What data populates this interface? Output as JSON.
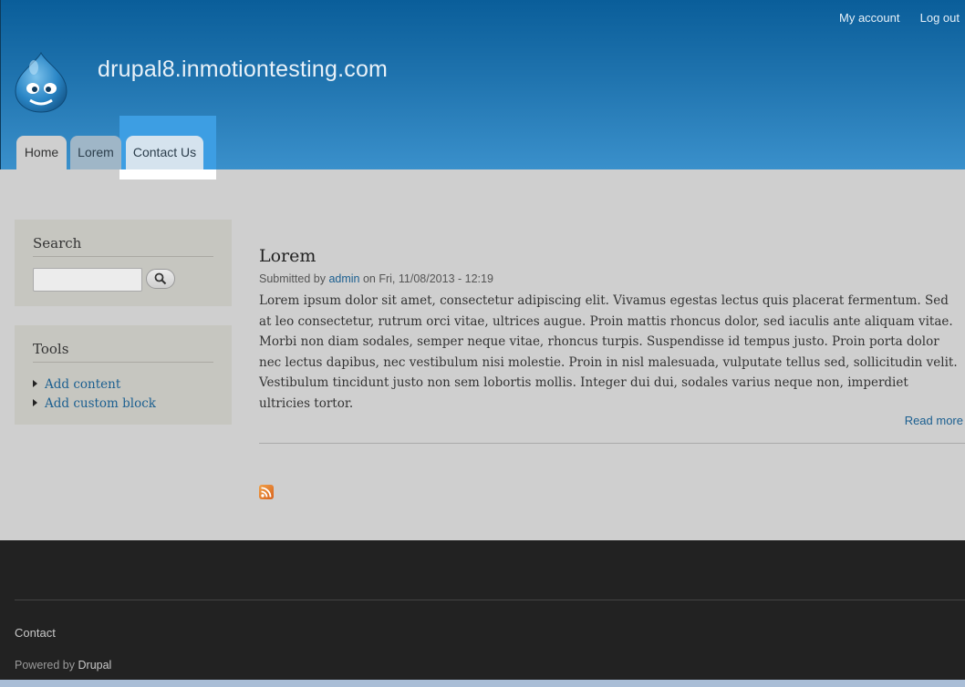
{
  "header": {
    "site_name": "drupal8.inmotiontesting.com",
    "secondary_menu": [
      "My account",
      "Log out"
    ],
    "logo_icon": "drupal-drop-icon"
  },
  "main_menu": {
    "tabs": [
      {
        "label": "Home",
        "state": "active"
      },
      {
        "label": "Lorem",
        "state": "normal"
      },
      {
        "label": "Contact Us",
        "state": "highlighted"
      }
    ]
  },
  "sidebar": {
    "search": {
      "title": "Search",
      "input_value": "",
      "button_icon": "search-icon"
    },
    "tools": {
      "title": "Tools",
      "links": [
        "Add content",
        "Add custom block"
      ]
    }
  },
  "node": {
    "title": "Lorem",
    "submitted_prefix": "Submitted by",
    "author": "admin",
    "submitted_suffix": "on Fri, 11/08/2013 - 12:19",
    "body": "Lorem ipsum dolor sit amet, consectetur adipiscing elit. Vivamus egestas lectus quis placerat fermentum. Sed at leo consectetur, rutrum orci vitae, ultrices augue. Proin mattis rhoncus dolor, sed iaculis ante aliquam vitae. Morbi non diam sodales, semper neque vitae, rhoncus turpis. Suspendisse id tempus justo. Proin porta dolor nec lectus dapibus, nec vestibulum nisi molestie. Proin in nisl malesuada, vulputate tellus sed, sollicitudin velit. Vestibulum tincidunt justo non sem lobortis mollis. Integer dui dui, sodales varius neque non, imperdiet ultricies tortor.",
    "read_more": "Read more"
  },
  "feed_icon": "rss-feed-icon",
  "footer": {
    "contact": "Contact",
    "powered_prefix": "Powered by",
    "powered_link": "Drupal"
  },
  "colors": {
    "header_top": "#0a5e9a",
    "header_bottom": "#3a90cb",
    "link": "#1b5f90",
    "highlight": "#3d9ee3",
    "footer": "#222222"
  }
}
